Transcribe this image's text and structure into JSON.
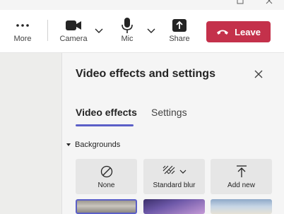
{
  "toolbar": {
    "more_label": "More",
    "camera_label": "Camera",
    "mic_label": "Mic",
    "share_label": "Share",
    "leave_label": "Leave"
  },
  "panel": {
    "title": "Video effects and settings",
    "tabs": [
      {
        "label": "Video effects",
        "active": true
      },
      {
        "label": "Settings",
        "active": false
      }
    ],
    "section_label": "Backgrounds",
    "tiles": [
      {
        "label": "None",
        "icon": "none-circle-icon"
      },
      {
        "label": "Standard blur",
        "icon": "blur-icon"
      },
      {
        "label": "Add new",
        "icon": "upload-icon"
      }
    ],
    "thumbnails": [
      "background-image-1",
      "background-image-2",
      "background-image-3"
    ]
  },
  "colors": {
    "accent": "#5b5fc7",
    "leave": "#c4314b",
    "panel_bg": "#f5f5f5",
    "toolbar_bg": "#ffffff"
  }
}
